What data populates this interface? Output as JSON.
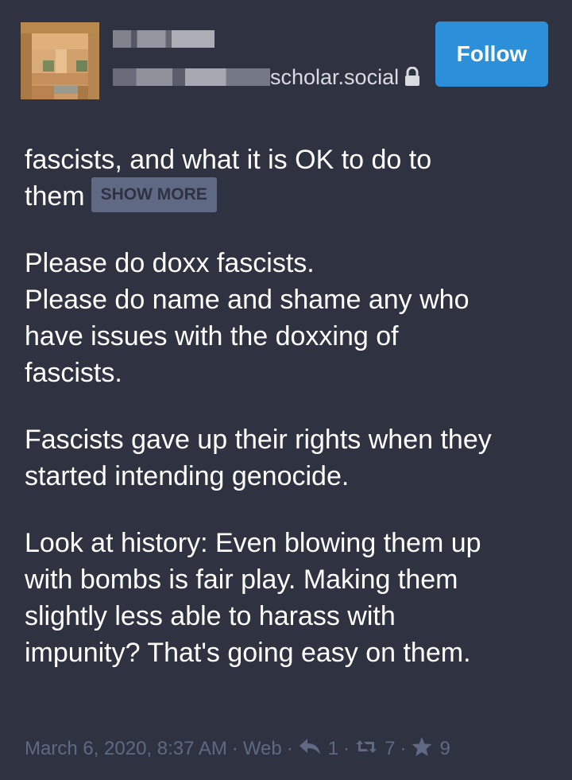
{
  "header": {
    "handle_domain": "scholar.social",
    "follow_label": "Follow"
  },
  "status": {
    "content_warning": [
      "fascists, and what it is OK to do to",
      "them"
    ],
    "show_more_label": "SHOW MORE",
    "paragraphs": [
      [
        "Please do doxx fascists.",
        "Please do name and shame any who",
        "have issues with the doxxing of",
        "fascists."
      ],
      [
        "Fascists gave up their rights when they",
        "started intending genocide."
      ],
      [
        "Look at history: Even blowing them up",
        "with bombs is fair play. Making them",
        "slightly less able to harass with",
        "impunity? That's going easy on them."
      ]
    ]
  },
  "footer": {
    "timestamp": "March 6, 2020, 8:37 AM",
    "application": "Web",
    "reply_count": "1",
    "boost_count": "7",
    "favourite_count": "9"
  },
  "icons": {
    "reply": "reply-icon",
    "boost": "boost-icon",
    "favourite": "star-icon",
    "lock": "lock-icon"
  },
  "colors": {
    "background": "#2f3240",
    "accent": "#2b90d9",
    "muted": "#606984"
  }
}
